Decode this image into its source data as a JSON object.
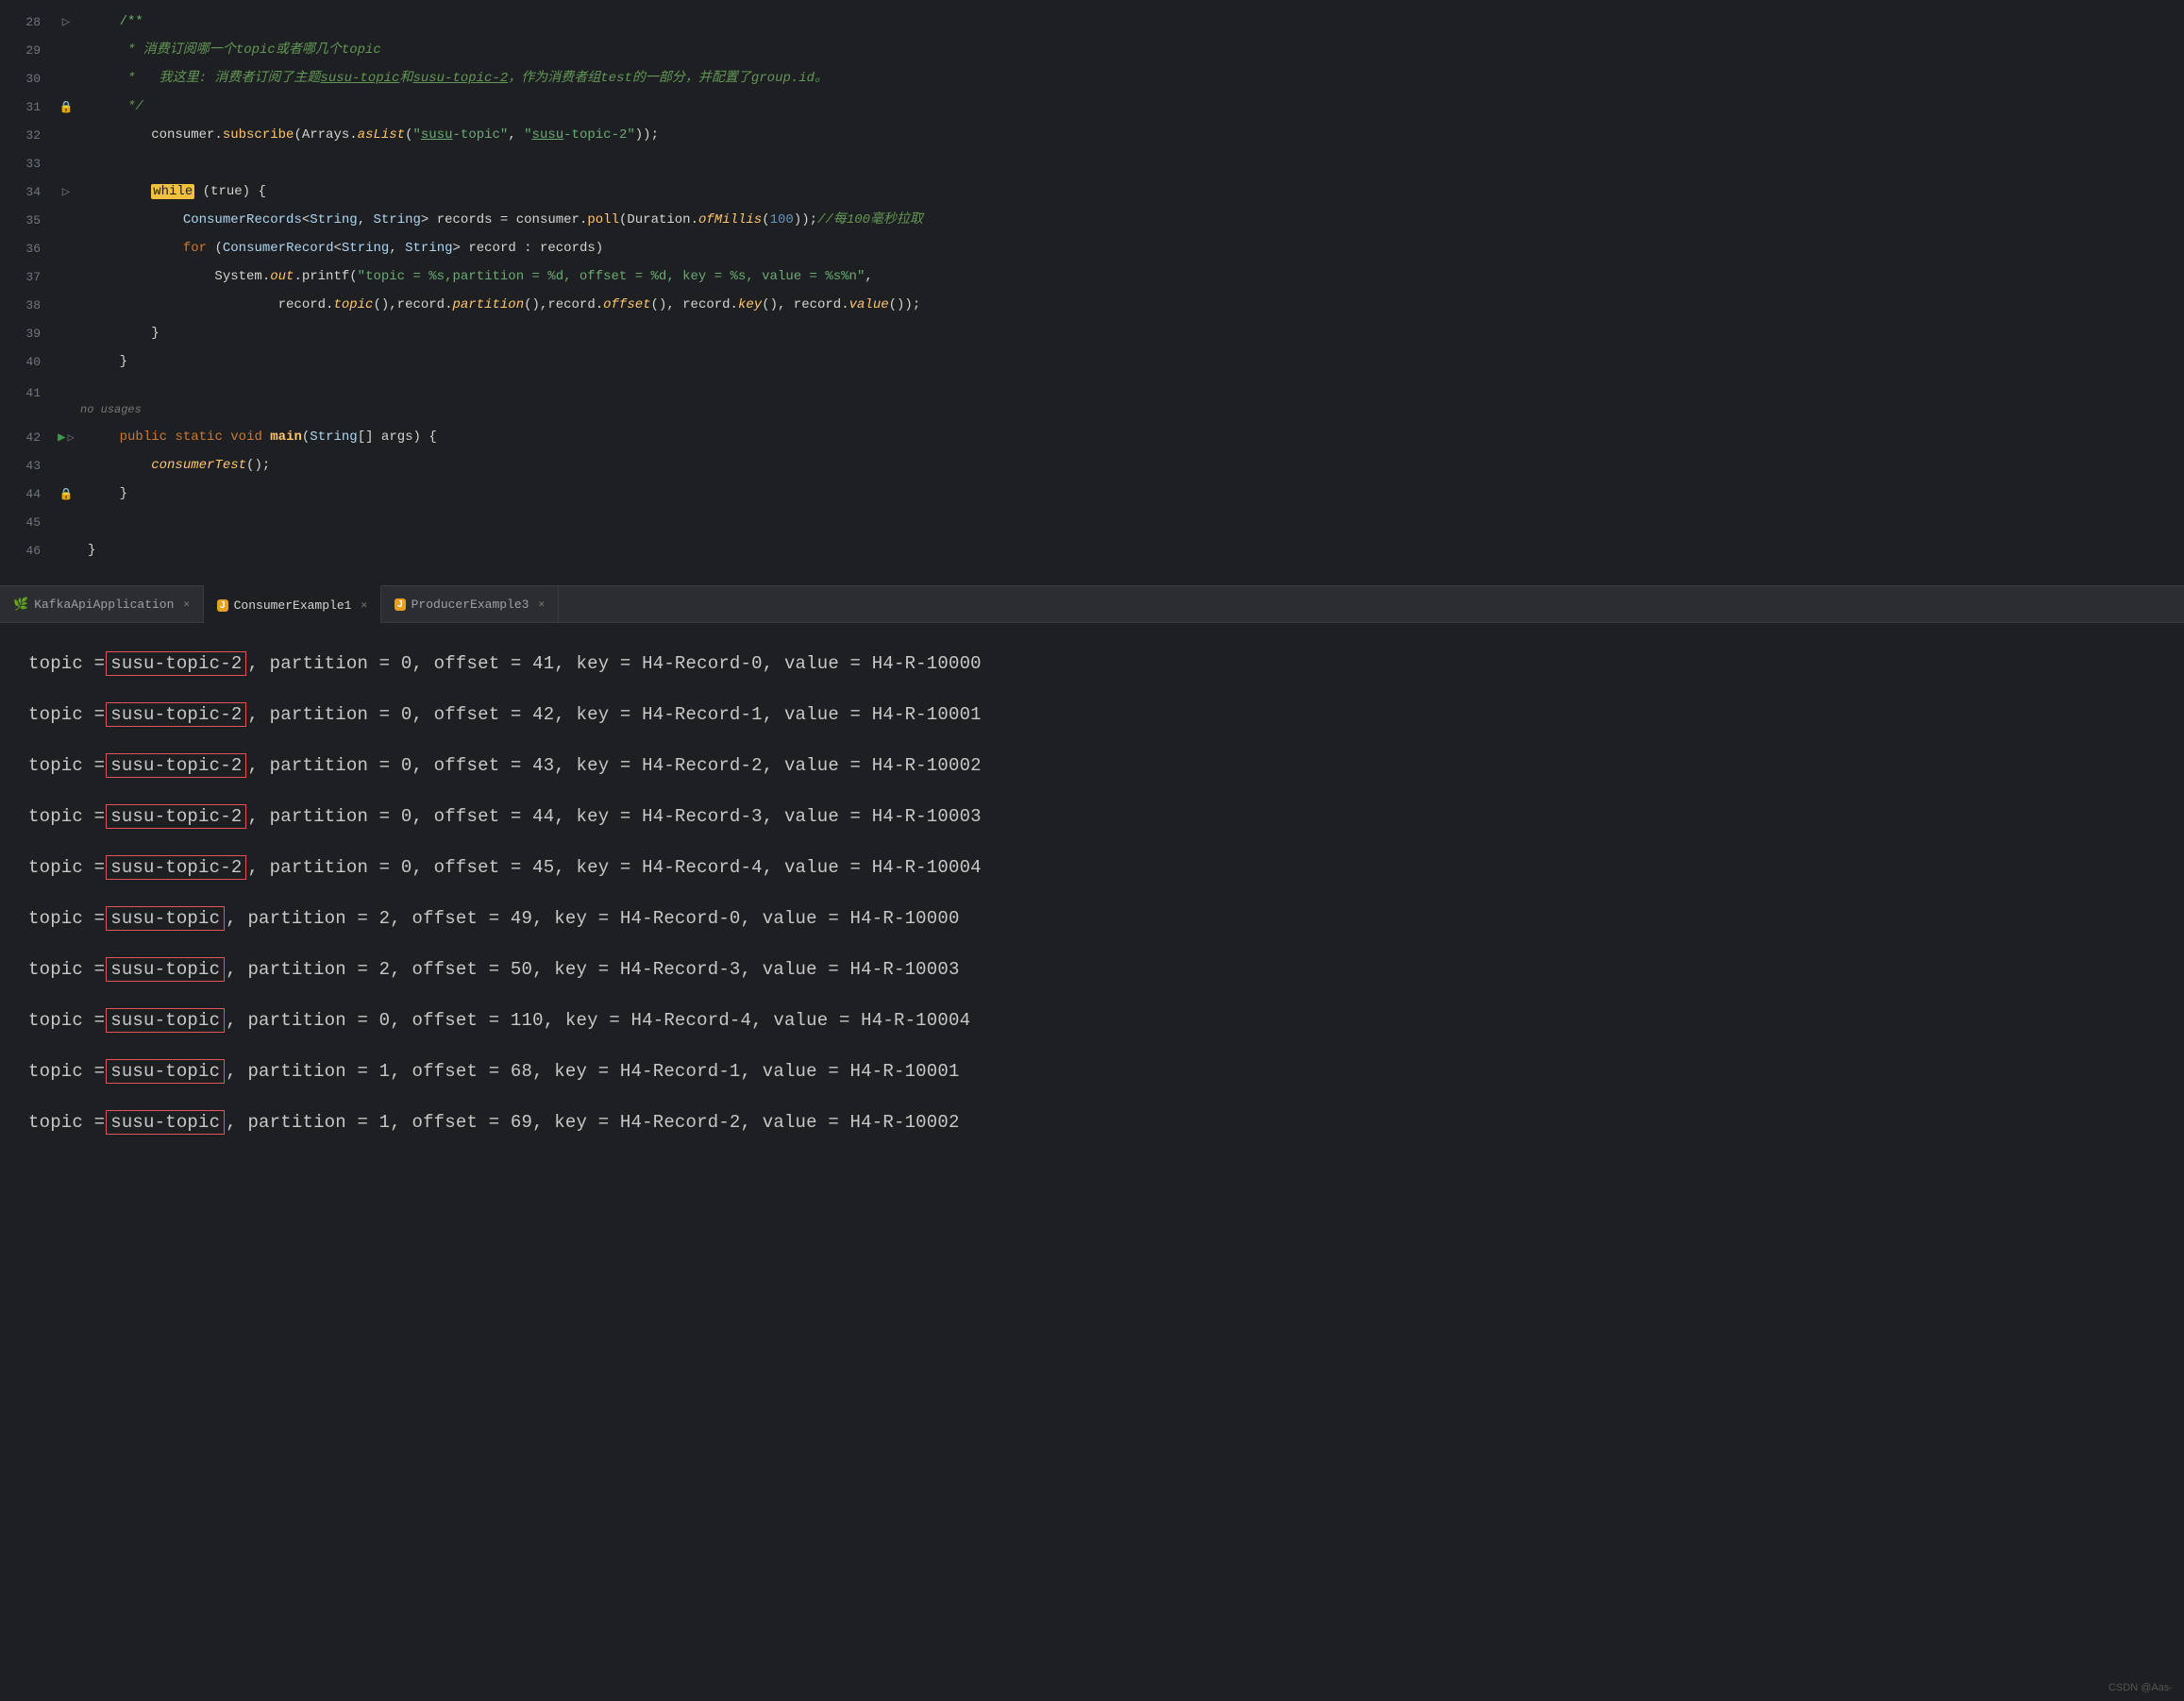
{
  "editor": {
    "lines": [
      {
        "number": "28",
        "gutter": "fold",
        "content": "    /**"
      },
      {
        "number": "29",
        "gutter": "",
        "content": "     * 消费订阅哪一个topic或者哪几个topic"
      },
      {
        "number": "30",
        "gutter": "",
        "content": "     *   我这里: 消费者订阅了主题susu-topic和susu-topic-2，作为消费者组test的一部分，并配置了group.id。"
      },
      {
        "number": "31",
        "gutter": "",
        "content": "     */"
      },
      {
        "number": "32",
        "gutter": "",
        "content": "        consumer.subscribe(Arrays.asList(\"susu-topic\", \"susu-topic-2\"));"
      },
      {
        "number": "33",
        "gutter": "",
        "content": ""
      },
      {
        "number": "34",
        "gutter": "fold",
        "content": "        while (true) {"
      },
      {
        "number": "35",
        "gutter": "",
        "content": "            ConsumerRecords<String, String> records = consumer.poll(Duration.ofMillis(100));//每100毫秒拉取"
      },
      {
        "number": "36",
        "gutter": "",
        "content": "            for (ConsumerRecord<String, String> record : records)"
      },
      {
        "number": "37",
        "gutter": "",
        "content": "                System.out.printf(\"topic = %s,partition = %d, offset = %d, key = %s, value = %s%n\","
      },
      {
        "number": "38",
        "gutter": "",
        "content": "                        record.topic(),record.partition(),record.offset(), record.key(), record.value());"
      },
      {
        "number": "39",
        "gutter": "",
        "content": "        }"
      },
      {
        "number": "40",
        "gutter": "",
        "content": "    }"
      },
      {
        "number": "41",
        "gutter": "",
        "content": ""
      },
      {
        "number": "42",
        "gutter": "run",
        "content": "    public static void main(String[] args) {"
      },
      {
        "number": "43",
        "gutter": "",
        "content": "        consumerTest();"
      },
      {
        "number": "44",
        "gutter": "",
        "content": "    }"
      },
      {
        "number": "45",
        "gutter": "",
        "content": ""
      },
      {
        "number": "46",
        "gutter": "",
        "content": "}"
      }
    ]
  },
  "tabs": [
    {
      "label": "KafkaApiApplication",
      "type": "spring",
      "active": false
    },
    {
      "label": "ConsumerExample1",
      "type": "java",
      "active": true
    },
    {
      "label": "ProducerExample3",
      "type": "java",
      "active": false
    }
  ],
  "console": {
    "lines": [
      {
        "prefix": "topic = ",
        "topic": "susu-topic-2",
        "suffix": ", partition = 0, offset = 41, key = H4-Record-0, value = H4-R-10000"
      },
      {
        "prefix": "topic = ",
        "topic": "susu-topic-2",
        "suffix": ", partition = 0, offset = 42, key = H4-Record-1, value = H4-R-10001"
      },
      {
        "prefix": "topic = ",
        "topic": "susu-topic-2",
        "suffix": ", partition = 0, offset = 43, key = H4-Record-2, value = H4-R-10002"
      },
      {
        "prefix": "topic = ",
        "topic": "susu-topic-2",
        "suffix": ", partition = 0, offset = 44, key = H4-Record-3, value = H4-R-10003"
      },
      {
        "prefix": "topic = ",
        "topic": "susu-topic-2",
        "suffix": ", partition = 0, offset = 45, key = H4-Record-4, value = H4-R-10004"
      },
      {
        "prefix": "topic = ",
        "topic": "susu-topic",
        "suffix": ", partition = 2, offset = 49, key = H4-Record-0, value = H4-R-10000"
      },
      {
        "prefix": "topic = ",
        "topic": "susu-topic",
        "suffix": ", partition = 2, offset = 50, key = H4-Record-3, value = H4-R-10003"
      },
      {
        "prefix": "topic = ",
        "topic": "susu-topic",
        "suffix": ", partition = 0, offset = 110, key = H4-Record-4, value = H4-R-10004"
      },
      {
        "prefix": "topic = ",
        "topic": "susu-topic",
        "suffix": ", partition = 1, offset = 68, key = H4-Record-1, value = H4-R-10001"
      },
      {
        "prefix": "topic = ",
        "topic": "susu-topic",
        "suffix": ", partition = 1, offset = 69, key = H4-Record-2, value = H4-R-10002"
      }
    ]
  },
  "watermark": "CSDN @Aas-"
}
